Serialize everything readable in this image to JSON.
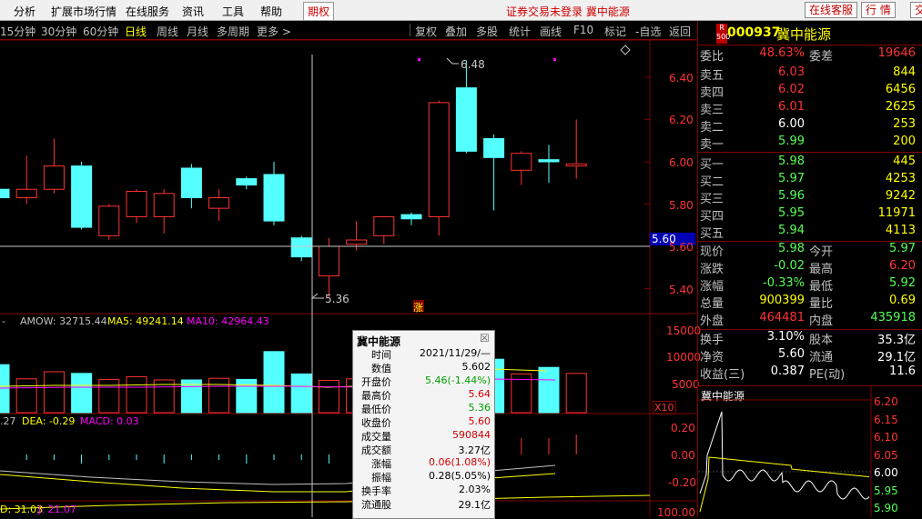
{
  "menu": [
    "分析",
    "扩展市场行情",
    "在线服务",
    "资讯",
    "工具",
    "帮助"
  ],
  "menu_qx": "期权",
  "notice": "证券交易未登录 冀中能源",
  "btn_service": "在线客服",
  "btn_quote": "行 情",
  "btn_edge": "交",
  "periods": [
    "15分钟",
    "30分钟",
    "60分钟",
    "日线",
    "周线",
    "月线",
    "多周期",
    "更多 >"
  ],
  "active_period": "日线",
  "tools": [
    "复权",
    "叠加",
    "多股",
    "统计",
    "画线",
    "F10",
    "标记",
    "-自选",
    "返回"
  ],
  "colors": {
    "up": "#ff3232",
    "down": "#54ffff",
    "bg": "#000000",
    "gold": "#ffff00",
    "magenta": "#ff00ff",
    "axis_red": "#800000"
  },
  "price_axis": [
    "6.40",
    "6.20",
    "6.00",
    "5.80",
    "5.60",
    "5.40"
  ],
  "crosshair_price": "5.60",
  "annot_high": "6.48",
  "annot_low": "5.36",
  "zhang_mark": "涨",
  "diamond_icon": "diamond-icon",
  "vol_header": {
    "left": "-",
    "amow": "AMOW: 32715.44",
    "ma5": "MA5: 49241.14",
    "ma10": "MA10: 42964.43"
  },
  "vol_axis": [
    "15000",
    "10000",
    "5000",
    "X10"
  ],
  "macd_header": {
    "diff": ".27",
    "dea": "DEA: -0.29",
    "macd": "MACD: 0.03"
  },
  "macd_axis": [
    "0.20",
    "0.00",
    "-0.20"
  ],
  "kdj_header": {
    "d": "D: 31.03",
    "j": "J: 21.07"
  },
  "kdj_axis": "100.00",
  "quote": {
    "code": "000937",
    "name": "冀中能源",
    "badge_top": "R",
    "badge_bottom": "500",
    "weibi_label": "委比",
    "weibi": "48.63%",
    "weicha_label": "委差",
    "weicha": "19646",
    "sell": [
      {
        "label": "卖五",
        "price": "6.03",
        "vol": "844"
      },
      {
        "label": "卖四",
        "price": "6.02",
        "vol": "6456"
      },
      {
        "label": "卖三",
        "price": "6.01",
        "vol": "2625"
      },
      {
        "label": "卖二",
        "price": "6.00",
        "vol": "253"
      },
      {
        "label": "卖一",
        "price": "5.99",
        "vol": "200"
      }
    ],
    "buy": [
      {
        "label": "买一",
        "price": "5.98",
        "vol": "445"
      },
      {
        "label": "买二",
        "price": "5.97",
        "vol": "4253"
      },
      {
        "label": "买三",
        "price": "5.96",
        "vol": "9242"
      },
      {
        "label": "买四",
        "price": "5.95",
        "vol": "11971"
      },
      {
        "label": "买五",
        "price": "5.94",
        "vol": "4113"
      }
    ],
    "stats": [
      {
        "l1": "现价",
        "v1": "5.98",
        "l2": "今开",
        "v2": "5.97"
      },
      {
        "l1": "涨跌",
        "v1": "-0.02",
        "l2": "最高",
        "v2": "6.20"
      },
      {
        "l1": "涨幅",
        "v1": "-0.33%",
        "l2": "最低",
        "v2": "5.92"
      },
      {
        "l1": "总量",
        "v1": "900399",
        "l2": "量比",
        "v2": "0.69"
      },
      {
        "l1": "外盘",
        "v1": "464481",
        "l2": "内盘",
        "v2": "435918"
      }
    ],
    "stats2": [
      {
        "l1": "换手",
        "v1": "3.10%",
        "l2": "股本",
        "v2": "35.3亿"
      },
      {
        "l1": "净资",
        "v1": "5.60",
        "l2": "流通",
        "v2": "29.1亿"
      },
      {
        "l1": "收益(三)",
        "v1": "0.387",
        "l2": "PE(动)",
        "v2": "11.6"
      }
    ]
  },
  "mini": {
    "title": "冀中能源",
    "axis": [
      "6.20",
      "6.15",
      "6.10",
      "6.05",
      "6.00",
      "5.95",
      "5.90"
    ]
  },
  "popup": {
    "title": "冀中能源",
    "close": "☒",
    "rows": [
      {
        "k": "时间",
        "v": "2021/11/29/—"
      },
      {
        "k": "数值",
        "v": "5.602"
      },
      {
        "k": "开盘价",
        "v": "5.46(-1.44%)"
      },
      {
        "k": "最高价",
        "v": "5.64"
      },
      {
        "k": "最低价",
        "v": "5.36"
      },
      {
        "k": "收盘价",
        "v": "5.60"
      },
      {
        "k": "成交量",
        "v": "590844"
      },
      {
        "k": "成交额",
        "v": "3.27亿"
      },
      {
        "k": "涨幅",
        "v": "0.06(1.08%)"
      },
      {
        "k": "振幅",
        "v": "0.28(5.05%)"
      },
      {
        "k": "换手率",
        "v": "2.03%"
      },
      {
        "k": "流通股",
        "v": "29.1亿"
      }
    ]
  },
  "chart_data": {
    "type": "candlestick",
    "candles": [
      {
        "o": 5.87,
        "c": 5.83,
        "h": 5.92,
        "l": 5.8
      },
      {
        "o": 5.83,
        "c": 5.87,
        "h": 6.03,
        "l": 5.8
      },
      {
        "o": 5.87,
        "c": 5.98,
        "h": 6.11,
        "l": 5.85
      },
      {
        "o": 5.98,
        "c": 5.69,
        "h": 6.0,
        "l": 5.68
      },
      {
        "o": 5.65,
        "c": 5.79,
        "h": 5.8,
        "l": 5.63
      },
      {
        "o": 5.74,
        "c": 5.86,
        "h": 5.87,
        "l": 5.71
      },
      {
        "o": 5.74,
        "c": 5.85,
        "h": 5.87,
        "l": 5.66
      },
      {
        "o": 5.97,
        "c": 5.83,
        "h": 5.99,
        "l": 5.78
      },
      {
        "o": 5.78,
        "c": 5.83,
        "h": 5.87,
        "l": 5.72
      },
      {
        "o": 5.92,
        "c": 5.89,
        "h": 5.93,
        "l": 5.87
      },
      {
        "o": 5.94,
        "c": 5.72,
        "h": 6.0,
        "l": 5.7
      },
      {
        "o": 5.64,
        "c": 5.55,
        "h": 5.65,
        "l": 5.53
      },
      {
        "o": 5.46,
        "c": 5.6,
        "h": 5.64,
        "l": 5.36
      },
      {
        "o": 5.61,
        "c": 5.63,
        "h": 5.72,
        "l": 5.58
      },
      {
        "o": 5.65,
        "c": 5.74,
        "h": 5.74,
        "l": 5.61
      },
      {
        "o": 5.75,
        "c": 5.73,
        "h": 5.76,
        "l": 5.7
      },
      {
        "o": 5.74,
        "c": 6.28,
        "h": 6.29,
        "l": 5.65
      },
      {
        "o": 6.35,
        "c": 6.05,
        "h": 6.48,
        "l": 6.04
      },
      {
        "o": 6.11,
        "c": 6.02,
        "h": 6.13,
        "l": 5.77
      },
      {
        "o": 5.96,
        "c": 6.04,
        "h": 6.05,
        "l": 5.89
      },
      {
        "o": 6.01,
        "c": 6.0,
        "h": 6.08,
        "l": 5.9
      },
      {
        "o": 5.98,
        "c": 5.99,
        "h": 6.2,
        "l": 5.92
      }
    ],
    "volumes": [
      8800,
      6200,
      7500,
      7200,
      6100,
      6600,
      6000,
      6000,
      6300,
      6100,
      11200,
      7100,
      5908,
      6200,
      8000,
      9000,
      12500,
      11000,
      9800,
      7100,
      8300,
      7200
    ],
    "ylim": [
      5.3,
      6.55
    ]
  }
}
